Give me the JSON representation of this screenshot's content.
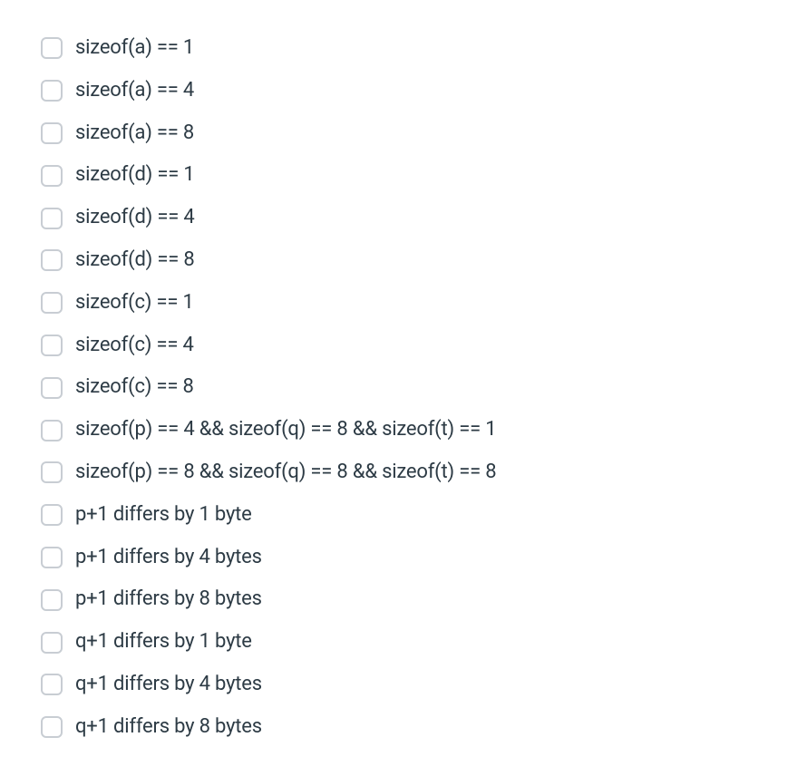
{
  "options": [
    {
      "label": "sizeof(a) == 1"
    },
    {
      "label": "sizeof(a) == 4"
    },
    {
      "label": "sizeof(a) == 8"
    },
    {
      "label": "sizeof(d) == 1"
    },
    {
      "label": "sizeof(d) == 4"
    },
    {
      "label": "sizeof(d) == 8"
    },
    {
      "label": "sizeof(c) == 1"
    },
    {
      "label": "sizeof(c) == 4"
    },
    {
      "label": "sizeof(c) == 8"
    },
    {
      "label": "sizeof(p) == 4 && sizeof(q) == 8 && sizeof(t) == 1"
    },
    {
      "label": "sizeof(p) == 8 && sizeof(q) == 8 && sizeof(t) == 8"
    },
    {
      "label": "p+1 differs by 1 byte"
    },
    {
      "label": "p+1 differs by 4 bytes"
    },
    {
      "label": "p+1 differs by 8 bytes"
    },
    {
      "label": "q+1 differs by 1 byte"
    },
    {
      "label": "q+1 differs by 4 bytes"
    },
    {
      "label": "q+1 differs by 8 bytes"
    }
  ]
}
